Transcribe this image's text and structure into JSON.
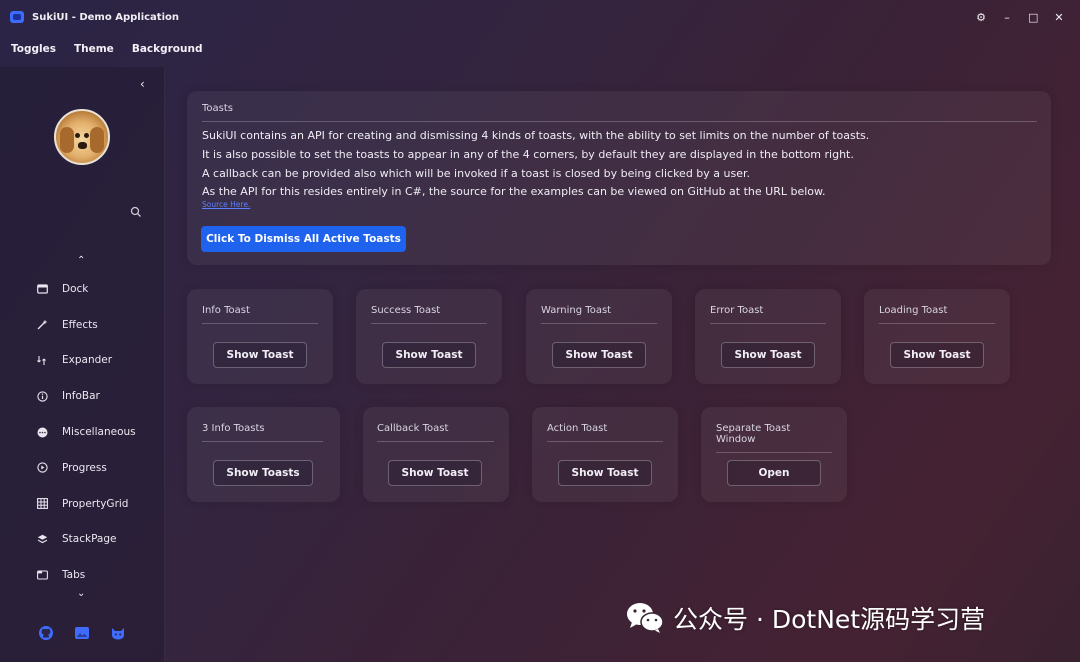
{
  "window": {
    "title": "SukiUI - Demo Application",
    "controls": {
      "settings": "⚙",
      "minimize": "–",
      "maximize": "□",
      "close": "✕"
    }
  },
  "menu": {
    "items": [
      "Toggles",
      "Theme",
      "Background"
    ]
  },
  "sidebar": {
    "collapse_glyph": "‹",
    "up_glyph": "⌃",
    "down_glyph": "⌄",
    "items": [
      {
        "label": "Dock",
        "icon": "dock-icon"
      },
      {
        "label": "Effects",
        "icon": "wand-icon"
      },
      {
        "label": "Expander",
        "icon": "expander-icon"
      },
      {
        "label": "InfoBar",
        "icon": "info-icon"
      },
      {
        "label": "Miscellaneous",
        "icon": "dots-icon"
      },
      {
        "label": "Progress",
        "icon": "progress-icon"
      },
      {
        "label": "PropertyGrid",
        "icon": "grid-icon"
      },
      {
        "label": "StackPage",
        "icon": "layers-icon"
      },
      {
        "label": "Tabs",
        "icon": "tabs-icon"
      }
    ],
    "footer_icons": [
      "github-icon",
      "image-icon",
      "cat-icon"
    ]
  },
  "toasts_card": {
    "header": "Toasts",
    "lines": [
      "SukiUI contains an API for creating and dismissing 4 kinds of toasts, with the ability to set limits on the number of toasts.",
      "It is also possible to set the toasts to appear in any of the 4 corners, by default they are displayed in the bottom right.",
      "A callback can be provided also which will be invoked if a toast is closed by being clicked by a user.",
      "As the API for this resides entirely in C#, the source for the examples can be viewed on GitHub at the URL below."
    ],
    "source_link": "Source Here.",
    "dismiss_button": "Click To Dismiss All Active Toasts"
  },
  "toast_cards": [
    {
      "title": "Info Toast",
      "button": "Show Toast"
    },
    {
      "title": "Success Toast",
      "button": "Show Toast"
    },
    {
      "title": "Warning Toast",
      "button": "Show Toast"
    },
    {
      "title": "Error Toast",
      "button": "Show Toast"
    },
    {
      "title": "Loading Toast",
      "button": "Show Toast"
    },
    {
      "title": "3 Info Toasts",
      "button": "Show Toasts"
    },
    {
      "title": "Callback Toast",
      "button": "Show Toast"
    },
    {
      "title": "Action Toast",
      "button": "Show Toast"
    },
    {
      "title": "Separate Toast Window",
      "button": "Open"
    }
  ],
  "watermark": {
    "text": "公众号 · DotNet源码学习营"
  },
  "colors": {
    "accent": "#1e62ee",
    "link": "#5d7fff"
  }
}
